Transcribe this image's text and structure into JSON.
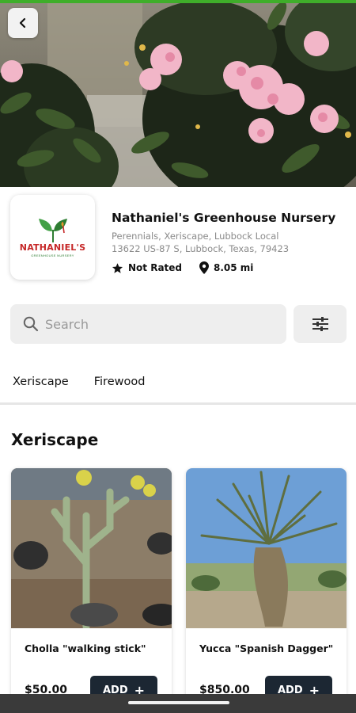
{
  "colors": {
    "accent": "#3fae2a",
    "button_dark": "#1c2733",
    "muted_text": "#8a8a8a",
    "search_bg": "#eeeeee"
  },
  "header": {
    "back_icon": "chevron-left-icon"
  },
  "store": {
    "logo_text": "NATHANIEL'S",
    "logo_subtext": "GREENHOUSE NURSERY",
    "name": "Nathaniel's Greenhouse Nursery",
    "categories": "Perennials, Xeriscape, Lubbock Local",
    "address": "13622 US-87 S, Lubbock, Texas, 79423",
    "rating": "Not Rated",
    "distance": "8.05 mi"
  },
  "search": {
    "placeholder": "Search",
    "icon": "search-icon",
    "filter_icon": "sliders-icon"
  },
  "tabs": [
    {
      "label": "Xeriscape"
    },
    {
      "label": "Firewood"
    }
  ],
  "section": {
    "title": "Xeriscape"
  },
  "products": [
    {
      "name": "Cholla \"walking stick\"",
      "price": "$50.00",
      "button_label": "ADD"
    },
    {
      "name": "Yucca \"Spanish Dagger\"",
      "price": "$850.00",
      "button_label": "ADD"
    }
  ]
}
